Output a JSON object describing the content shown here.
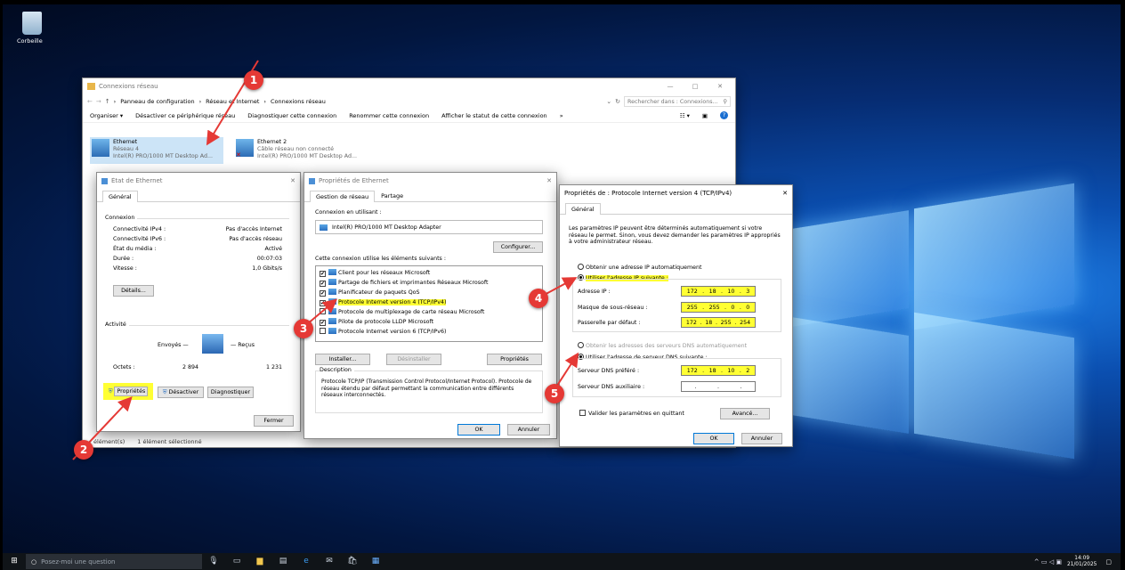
{
  "desktop": {
    "recycle_label": "Corbeille"
  },
  "explorer": {
    "title": "Connexions réseau",
    "breadcrumb": [
      "Panneau de configuration",
      "Réseau et Internet",
      "Connexions réseau"
    ],
    "search_placeholder": "Rechercher dans : Connexions...",
    "toolbar": [
      "Organiser ▾",
      "Désactiver ce périphérique réseau",
      "Diagnostiquer cette connexion",
      "Renommer cette connexion",
      "Afficher le statut de cette connexion",
      "»"
    ],
    "adapters": [
      {
        "name": "Ethernet",
        "network": "Réseau 4",
        "device": "Intel(R) PRO/1000 MT Desktop Ad..."
      },
      {
        "name": "Ethernet 2",
        "network": "Câble réseau non connecté",
        "device": "Intel(R) PRO/1000 MT Desktop Ad..."
      }
    ],
    "status_left": "élément(s)",
    "status_sel": "1 élément sélectionné"
  },
  "etat": {
    "title": "État de Ethernet",
    "tab": "Général",
    "connexion": "Connexion",
    "rows": [
      [
        "Connectivité IPv4 :",
        "Pas d'accès Internet"
      ],
      [
        "Connectivité IPv6 :",
        "Pas d'accès réseau"
      ],
      [
        "État du média :",
        "Activé"
      ],
      [
        "Durée :",
        "00:07:03"
      ],
      [
        "Vitesse :",
        "1,0 Gbits/s"
      ]
    ],
    "details": "Détails...",
    "activite": "Activité",
    "envoyes": "Envoyés —",
    "recus": "— Reçus",
    "octets": "Octets :",
    "sent": "2 894",
    "recv": "1 231",
    "proprietes": "Propriétés",
    "desactiver": "Désactiver",
    "diagnostiquer": "Diagnostiquer",
    "fermer": "Fermer"
  },
  "props": {
    "title": "Propriétés de Ethernet",
    "tabs": [
      "Gestion de réseau",
      "Partage"
    ],
    "conn_label": "Connexion en utilisant :",
    "adapter": "Intel(R) PRO/1000 MT Desktop Adapter",
    "configurer": "Configurer...",
    "items_label": "Cette connexion utilise les éléments suivants :",
    "items": [
      {
        "t": "Client pour les réseaux Microsoft",
        "c": "✔"
      },
      {
        "t": "Partage de fichiers et imprimantes Réseaux Microsoft",
        "c": "✔"
      },
      {
        "t": "Planificateur de paquets QoS",
        "c": "✔"
      },
      {
        "t": "Protocole Internet version 4 (TCP/IPv4)",
        "c": "✔"
      },
      {
        "t": "Protocole de multiplexage de carte réseau Microsoft",
        "c": ""
      },
      {
        "t": "Pilote de protocole LLDP Microsoft",
        "c": "✔"
      },
      {
        "t": "Protocole Internet version 6 (TCP/IPv6)",
        "c": ""
      }
    ],
    "installer": "Installer...",
    "desinstaller": "Désinstaller",
    "proprietes": "Propriétés",
    "desc_label": "Description",
    "desc": "Protocole TCP/IP (Transmission Control Protocol/Internet Protocol). Protocole de réseau étendu par défaut permettant la communication entre différents réseaux interconnectés.",
    "ok": "OK",
    "annuler": "Annuler"
  },
  "ipv4": {
    "title": "Propriétés de : Protocole Internet version 4 (TCP/IPv4)",
    "tab": "Général",
    "intro": "Les paramètres IP peuvent être déterminés automatiquement si votre réseau le permet. Sinon, vous devez demander les paramètres IP appropriés à votre administrateur réseau.",
    "auto_ip": "Obtenir une adresse IP automatiquement",
    "manual_ip": "Utiliser l'adresse IP suivante :",
    "ip_label": "Adresse IP :",
    "ip": [
      "172",
      ".",
      "18",
      ".",
      "10",
      ".",
      "3"
    ],
    "mask_label": "Masque de sous-réseau :",
    "mask": [
      "255",
      ".",
      "255",
      ".",
      "0",
      ".",
      "0"
    ],
    "gw_label": "Passerelle par défaut :",
    "gw": [
      "172",
      ".",
      "18",
      ".",
      "255",
      ".",
      "254"
    ],
    "auto_dns": "Obtenir les adresses des serveurs DNS automatiquement",
    "manual_dns": "Utiliser l'adresse de serveur DNS suivante :",
    "dns1_label": "Serveur DNS préféré :",
    "dns1": [
      "172",
      ".",
      "18",
      ".",
      "10",
      ".",
      "2"
    ],
    "dns2_label": "Serveur DNS auxiliaire :",
    "dns2": [
      ".",
      ".",
      "."
    ],
    "validate": "Valider les paramètres en quittant",
    "avance": "Avancé...",
    "ok": "OK",
    "annuler": "Annuler"
  },
  "badges": [
    "1",
    "2",
    "3",
    "4",
    "5"
  ],
  "taskbar": {
    "search": "Posez-moi une question",
    "time": "14:09",
    "date": "21/01/2025"
  }
}
